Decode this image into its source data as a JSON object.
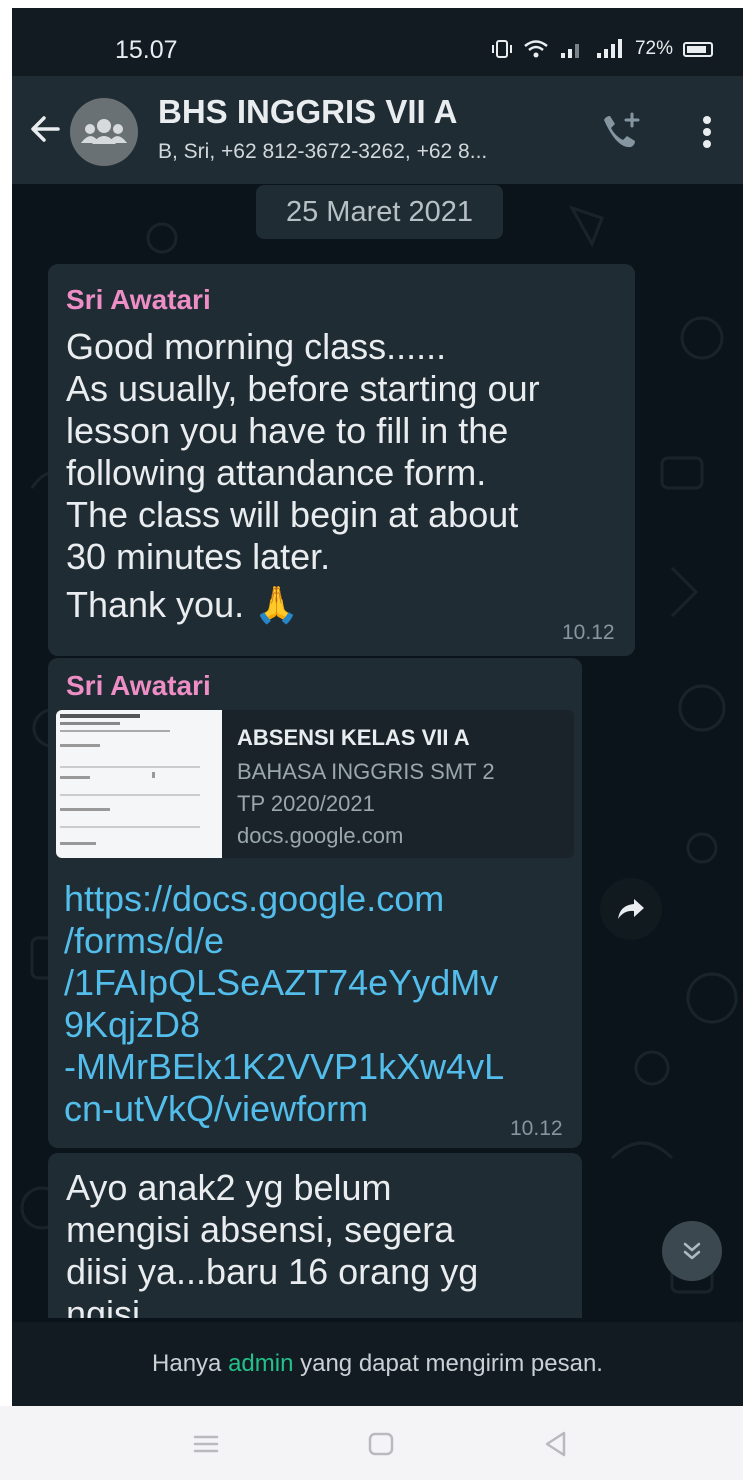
{
  "status_bar": {
    "time": "15.07",
    "battery": "72%"
  },
  "header": {
    "title": "BHS INGGRIS VII A",
    "subtitle": "B, Sri, +62 812-3672-3262, +62 8..."
  },
  "date_chip": "25 Maret 2021",
  "messages": [
    {
      "sender": "Sri Awatari",
      "lines": [
        "Good morning class......",
        "As usually, before starting our",
        "lesson you have to fill in the",
        "following attandance form.",
        "The class will begin at about",
        "30 minutes later.",
        "Thank you. 🙏"
      ],
      "time": "10.12"
    },
    {
      "sender": "Sri Awatari",
      "preview": {
        "title": "ABSENSI KELAS VII A",
        "line1": "BAHASA INGGRIS SMT 2",
        "line2": "TP 2020/2021",
        "domain": "docs.google.com"
      },
      "link_lines": [
        "https://docs.google.com",
        "/forms/d/e",
        "/1FAIpQLSeAZT74eYydMv",
        "9KqjzD8",
        "-MMrBElx1K2VVP1kXw4vL",
        "cn-utVkQ/viewform"
      ],
      "time": "10.12"
    },
    {
      "lines": [
        "Ayo anak2 yg belum",
        "mengisi absensi, segera",
        "diisi ya...baru 16 orang yg",
        "ngisi"
      ]
    }
  ],
  "footer": {
    "prefix": "Hanya",
    "admin": "admin",
    "suffix": "yang dapat mengirim pesan."
  },
  "icons": {
    "back": "arrow-left-icon",
    "group": "group-avatar-icon",
    "call": "add-call-icon",
    "menu": "more-vertical-icon",
    "forward": "forward-icon",
    "scroll": "chevron-double-down-icon"
  },
  "colors": {
    "chat_bg": "#0b141a",
    "bubble": "#202c33",
    "sender": "#ee8ec6",
    "link": "#53bdeb",
    "admin": "#24c08a"
  }
}
